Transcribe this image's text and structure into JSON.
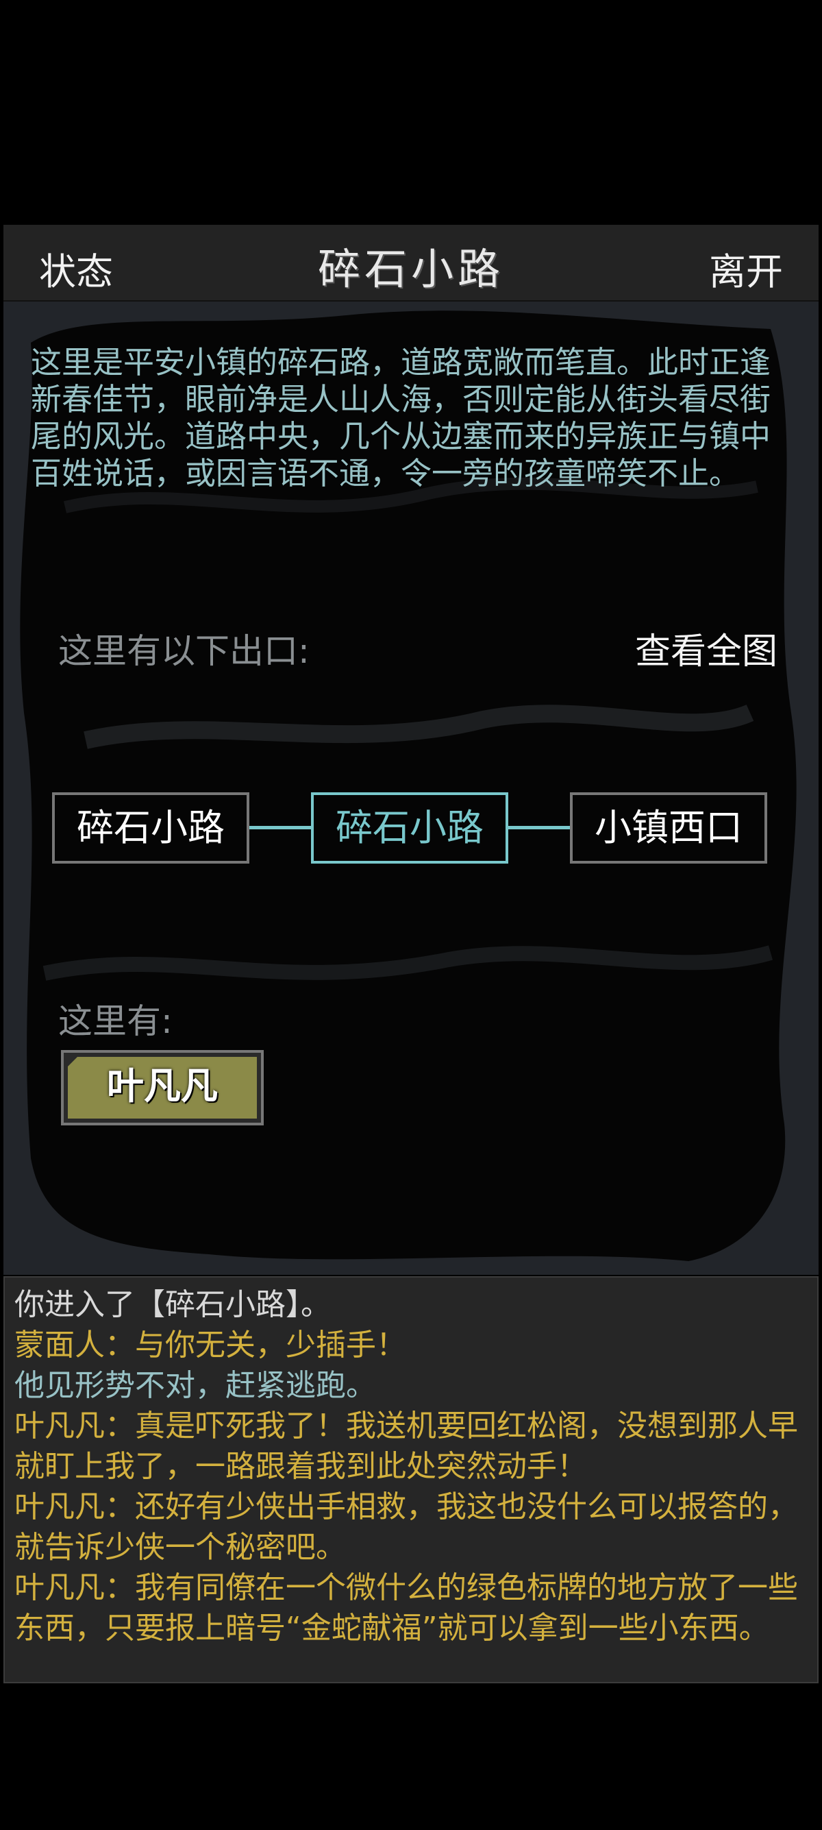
{
  "header": {
    "status_label": "状态",
    "title": "碎石小路",
    "leave_label": "离开"
  },
  "scene": {
    "description": "这里是平安小镇的碎石路，道路宽敞而笔直。此时正逢新春佳节，眼前净是人山人海，否则定能从街头看尽街尾的风光。道路中央，几个从边塞而来的异族正与镇中百姓说话，或因言语不通，令一旁的孩童啼笑不止。",
    "exits_label": "这里有以下出口:",
    "view_map_label": "查看全图",
    "exits": [
      {
        "label": "碎石小路"
      },
      {
        "label": "碎石小路",
        "current": true
      },
      {
        "label": "小镇西口"
      }
    ],
    "here_label": "这里有:",
    "npcs": [
      {
        "label": "叶凡凡"
      }
    ]
  },
  "log": {
    "lines": [
      {
        "text": "你进入了【碎石小路】。",
        "color": "#d9d9d9"
      },
      {
        "text": "蒙面人：与你无关，少插手！",
        "color": "#d4b13e"
      },
      {
        "text": "他见形势不对，赶紧逃跑。",
        "color": "#98c2c6"
      },
      {
        "text": "叶凡凡：真是吓死我了！我送机要回红松阁，没想到那人早就盯上我了，一路跟着我到此处突然动手！",
        "color": "#d4b13e"
      },
      {
        "text": "叶凡凡：还好有少侠出手相救，我这也没什么可以报答的，就告诉少侠一个秘密吧。",
        "color": "#d4b13e"
      },
      {
        "text": "叶凡凡：我有同僚在一个微什么的绿色标牌的地方放了一些东西，只要报上暗号“金蛇献福”就可以拿到一些小东西。",
        "color": "#d4b13e"
      }
    ]
  },
  "colors": {
    "accent": "#79c8cc",
    "description_text": "#98c2c6",
    "npc_fill": "#8b8a48",
    "dialogue": "#d4b13e"
  }
}
